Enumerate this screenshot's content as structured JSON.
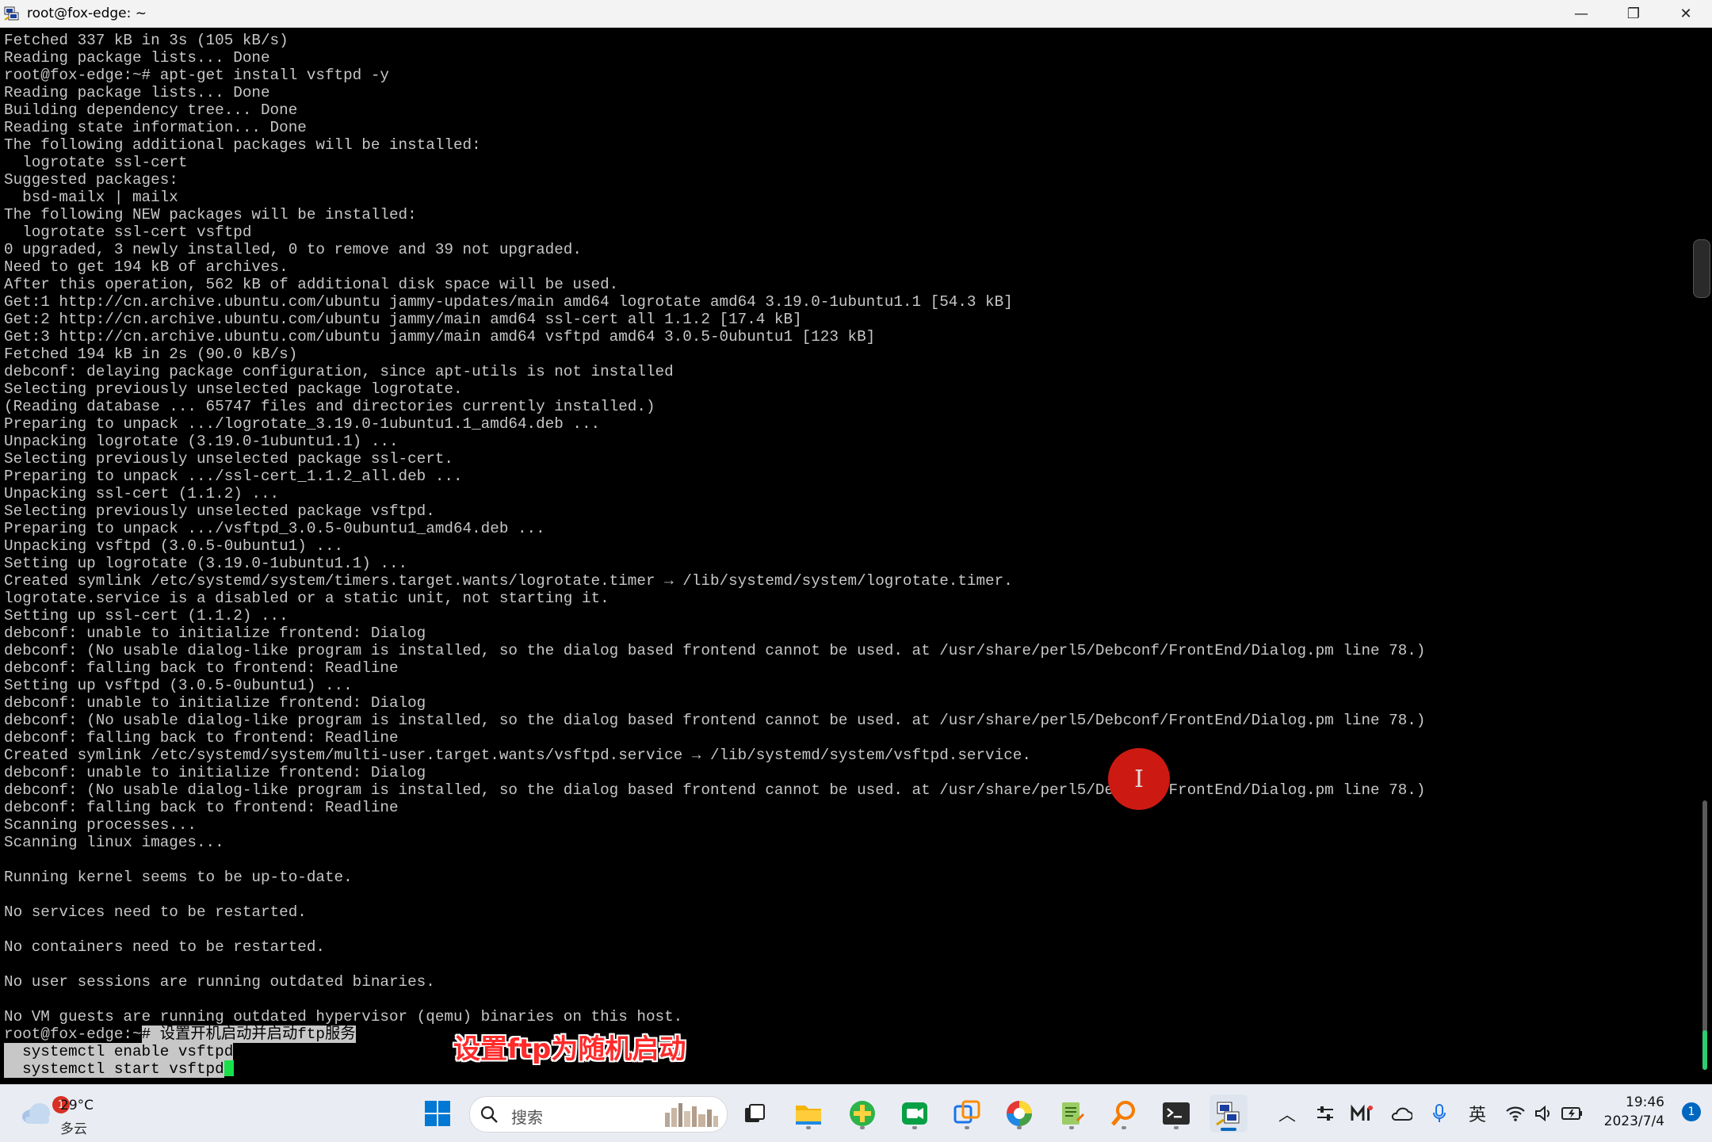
{
  "window": {
    "title": "root@fox-edge: ~",
    "minimize_glyph": "—",
    "restore_glyph": "❐",
    "close_glyph": "✕"
  },
  "terminal": {
    "lines": [
      "Fetched 337 kB in 3s (105 kB/s)",
      "Reading package lists... Done",
      "root@fox-edge:~# apt-get install vsftpd -y",
      "Reading package lists... Done",
      "Building dependency tree... Done",
      "Reading state information... Done",
      "The following additional packages will be installed:",
      "  logrotate ssl-cert",
      "Suggested packages:",
      "  bsd-mailx | mailx",
      "The following NEW packages will be installed:",
      "  logrotate ssl-cert vsftpd",
      "0 upgraded, 3 newly installed, 0 to remove and 39 not upgraded.",
      "Need to get 194 kB of archives.",
      "After this operation, 562 kB of additional disk space will be used.",
      "Get:1 http://cn.archive.ubuntu.com/ubuntu jammy-updates/main amd64 logrotate amd64 3.19.0-1ubuntu1.1 [54.3 kB]",
      "Get:2 http://cn.archive.ubuntu.com/ubuntu jammy/main amd64 ssl-cert all 1.1.2 [17.4 kB]",
      "Get:3 http://cn.archive.ubuntu.com/ubuntu jammy/main amd64 vsftpd amd64 3.0.5-0ubuntu1 [123 kB]",
      "Fetched 194 kB in 2s (90.0 kB/s)",
      "debconf: delaying package configuration, since apt-utils is not installed",
      "Selecting previously unselected package logrotate.",
      "(Reading database ... 65747 files and directories currently installed.)",
      "Preparing to unpack .../logrotate_3.19.0-1ubuntu1.1_amd64.deb ...",
      "Unpacking logrotate (3.19.0-1ubuntu1.1) ...",
      "Selecting previously unselected package ssl-cert.",
      "Preparing to unpack .../ssl-cert_1.1.2_all.deb ...",
      "Unpacking ssl-cert (1.1.2) ...",
      "Selecting previously unselected package vsftpd.",
      "Preparing to unpack .../vsftpd_3.0.5-0ubuntu1_amd64.deb ...",
      "Unpacking vsftpd (3.0.5-0ubuntu1) ...",
      "Setting up logrotate (3.19.0-1ubuntu1.1) ...",
      "Created symlink /etc/systemd/system/timers.target.wants/logrotate.timer → /lib/systemd/system/logrotate.timer.",
      "logrotate.service is a disabled or a static unit, not starting it.",
      "Setting up ssl-cert (1.1.2) ...",
      "debconf: unable to initialize frontend: Dialog",
      "debconf: (No usable dialog-like program is installed, so the dialog based frontend cannot be used. at /usr/share/perl5/Debconf/FrontEnd/Dialog.pm line 78.)",
      "debconf: falling back to frontend: Readline",
      "Setting up vsftpd (3.0.5-0ubuntu1) ...",
      "debconf: unable to initialize frontend: Dialog",
      "debconf: (No usable dialog-like program is installed, so the dialog based frontend cannot be used. at /usr/share/perl5/Debconf/FrontEnd/Dialog.pm line 78.)",
      "debconf: falling back to frontend: Readline",
      "Created symlink /etc/systemd/system/multi-user.target.wants/vsftpd.service → /lib/systemd/system/vsftpd.service.",
      "debconf: unable to initialize frontend: Dialog",
      "debconf: (No usable dialog-like program is installed, so the dialog based frontend cannot be used. at /usr/share/perl5/Debconf/FrontEnd/Dialog.pm line 78.)",
      "debconf: falling back to frontend: Readline",
      "Scanning processes...",
      "Scanning linux images...",
      "",
      "Running kernel seems to be up-to-date.",
      "",
      "No services need to be restarted.",
      "",
      "No containers need to be restarted.",
      "",
      "No user sessions are running outdated binaries.",
      "",
      "No VM guests are running outdated hypervisor (qemu) binaries on this host."
    ],
    "prompt": "root@fox-edge:~",
    "prompt_comment": "# 设置开机启动并启动ftp服务",
    "selected_cmd_1": "  systemctl enable vsftpd",
    "selected_cmd_2": "  systemctl start vsftpd"
  },
  "caption": "设置ftp为随机启动",
  "taskbar": {
    "weather_temp": "29°C",
    "weather_cond": "多云",
    "weather_badge": "1",
    "search_placeholder": "搜索",
    "ime": "英",
    "time": "19:46",
    "date": "2023/7/4",
    "notification_count": "1"
  },
  "colors": {
    "terminal_bg": "#000000",
    "terminal_fg": "#c7c7c7",
    "cursor": "#19e04a",
    "caption": "#ff2a2a",
    "accent": "#0067c0"
  }
}
